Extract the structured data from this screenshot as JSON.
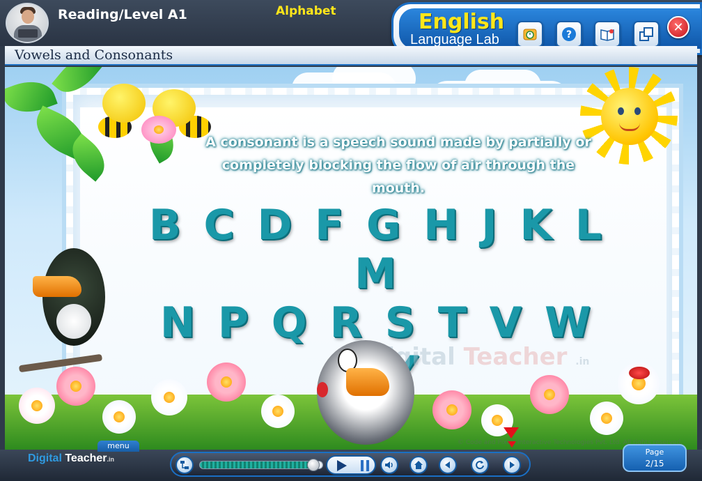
{
  "header": {
    "level_title": "Reading/Level A1",
    "topic_title": "Alphabet",
    "brand_line1": "English",
    "brand_line2": "Language Lab",
    "tools": [
      {
        "name": "timer-icon"
      },
      {
        "name": "help-icon"
      },
      {
        "name": "book-icon"
      },
      {
        "name": "window-icon"
      }
    ],
    "close_glyph": "✕"
  },
  "lesson": {
    "title": "Vowels and Consonants",
    "definition": "A consonant is a speech sound made by partially or completely blocking the flow of air through the mouth.",
    "letters_line1": "B C D F G H J K L M",
    "letters_line2": "N P Q R S T V W X Y",
    "letters_line3": "Z",
    "watermark_a": "Digital",
    "watermark_b": "Teacher",
    "watermark_c": ".in",
    "copyright": "© Code and Pixels Interactive Technologies Pvt. Ltd. All rights reserved."
  },
  "footer": {
    "menu_label": "menu",
    "logo_a": "Digital",
    "logo_b": "Teacher",
    "logo_c": ".in",
    "progress": 0.92,
    "page_label": "Page",
    "page_value": "2/15"
  },
  "colors": {
    "accent": "#1e6fc2",
    "letters": "#1a98a8",
    "brand_yellow": "#ffe61a"
  }
}
